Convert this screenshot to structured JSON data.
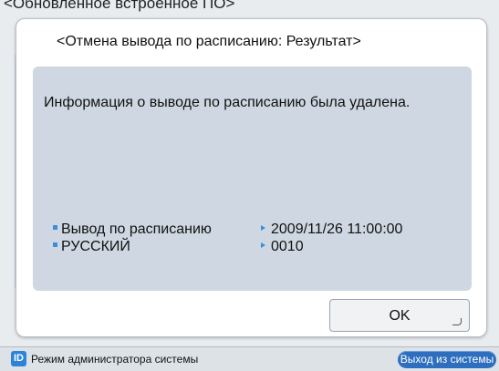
{
  "background": {
    "title": "<Обновленное встроенное ПО>"
  },
  "dialog": {
    "title": "<Отмена вывода по расписанию: Результат>",
    "message": "Информация о выводе по расписанию была удалена.",
    "rows": [
      {
        "label": "Вывод по расписанию",
        "value": "2009/11/26 11:00:00"
      },
      {
        "label": "РУССКИЙ",
        "value": "0010"
      }
    ],
    "ok_label": "OK"
  },
  "statusbar": {
    "admin_icon_text": "ID",
    "admin_mode_label": "Режим администратора системы",
    "logout_label": "Выход из системы"
  },
  "colors": {
    "accent": "#3a8fd9",
    "panel": "#cfd8e2",
    "logout_button": "#2d6fbe"
  }
}
